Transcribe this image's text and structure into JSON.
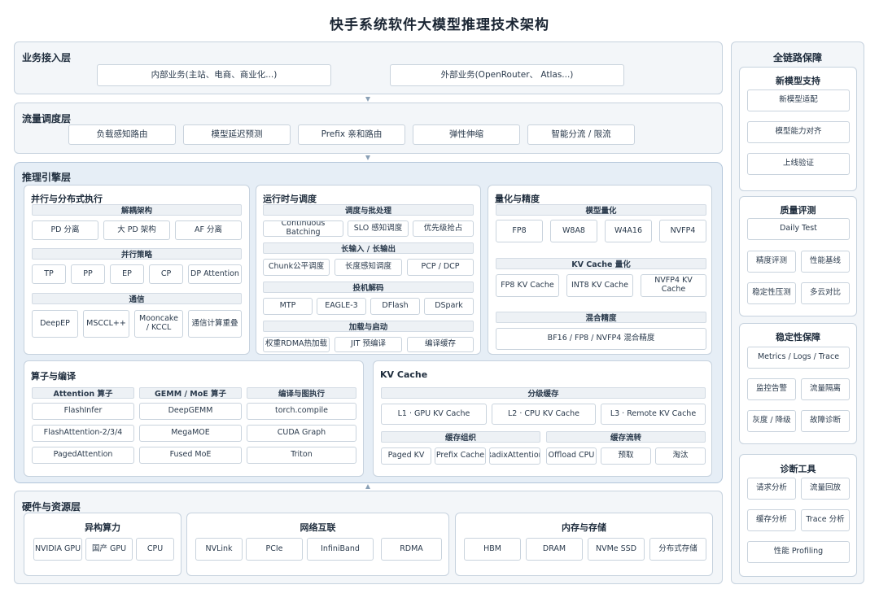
{
  "title": "快手系统软件大模型推理技术架构",
  "business_layer": {
    "title": "业务接入层",
    "items": [
      "内部业务(主站、电商、商业化...)",
      "外部业务(OpenRouter、 Atlas...)"
    ]
  },
  "traffic_layer": {
    "title": "流量调度层",
    "items": [
      "负载感知路由",
      "模型延迟预测",
      "Prefix 亲和路由",
      "弹性伸缩",
      "智能分流 / 限流"
    ]
  },
  "engine_layer": {
    "title": "推理引擎层",
    "parallel": {
      "title": "并行与分布式执行",
      "sections": [
        {
          "header": "解耦架构",
          "items": [
            "PD 分离",
            "大 PD 架构",
            "AF 分离"
          ]
        },
        {
          "header": "并行策略",
          "items": [
            "TP",
            "PP",
            "EP",
            "CP",
            "DP Attention"
          ]
        },
        {
          "header": "通信",
          "items": [
            "DeepEP",
            "MSCCL++",
            "Mooncake\n/ KCCL",
            "通信计算重叠"
          ]
        }
      ]
    },
    "runtime": {
      "title": "运行时与调度",
      "sections": [
        {
          "header": "调度与批处理",
          "items": [
            "Continuous Batching",
            "SLO 感知调度",
            "优先级抢占"
          ]
        },
        {
          "header": "长输入 / 长输出",
          "items": [
            "Chunk公平调度",
            "长度感知调度",
            "PCP / DCP"
          ]
        },
        {
          "header": "投机解码",
          "items": [
            "MTP",
            "EAGLE-3",
            "DFlash",
            "DSpark"
          ]
        },
        {
          "header": "加载与启动",
          "items": [
            "权重RDMA热加载",
            "JIT 预编译",
            "编译缓存"
          ]
        }
      ]
    },
    "quant": {
      "title": "量化与精度",
      "sections": [
        {
          "header": "模型量化",
          "items": [
            "FP8",
            "W8A8",
            "W4A16",
            "NVFP4"
          ]
        },
        {
          "header": "KV Cache 量化",
          "items": [
            "FP8 KV Cache",
            "INT8 KV Cache",
            "NVFP4 KV Cache"
          ]
        },
        {
          "header": "混合精度",
          "items": [
            "BF16 / FP8 / NVFP4 混合精度"
          ]
        }
      ]
    },
    "kernel": {
      "title": "算子与编译",
      "columns": [
        {
          "header": "Attention 算子",
          "items": [
            "FlashInfer",
            "FlashAttention-2/3/4",
            "PagedAttention"
          ]
        },
        {
          "header": "GEMM / MoE 算子",
          "items": [
            "DeepGEMM",
            "MegaMOE",
            "Fused MoE"
          ]
        },
        {
          "header": "编译与图执行",
          "items": [
            "torch.compile",
            "CUDA Graph",
            "Triton"
          ]
        }
      ]
    },
    "kvcache": {
      "title": "KV Cache",
      "tier": {
        "header": "分级缓存",
        "items": [
          "L1 · GPU KV Cache",
          "L2 · CPU KV Cache",
          "L3 · Remote KV Cache"
        ]
      },
      "org": {
        "header": "缓存组织",
        "items": [
          "Paged KV",
          "Prefix Cache",
          "RadixAttention"
        ]
      },
      "flow": {
        "header": "缓存流转",
        "items": [
          "Offload CPU",
          "预取",
          "淘汰"
        ]
      }
    }
  },
  "hardware_layer": {
    "title": "硬件与资源层",
    "groups": [
      {
        "title": "异构算力",
        "items": [
          "NVIDIA GPU",
          "国产 GPU",
          "CPU"
        ]
      },
      {
        "title": "网络互联",
        "items": [
          "NVLink",
          "PCIe",
          "InfiniBand",
          "RDMA"
        ]
      },
      {
        "title": "内存与存储",
        "items": [
          "HBM",
          "DRAM",
          "NVMe SSD",
          "分布式存储"
        ]
      }
    ]
  },
  "guarantee": {
    "title": "全链路保障",
    "groups": [
      {
        "title": "新模型支持",
        "items": [
          "新模型适配",
          "模型能力对齐",
          "上线验证"
        ]
      },
      {
        "title": "质量评测",
        "items": [
          "Daily Test",
          "精度评测",
          "性能基线",
          "稳定性压测",
          "多云对比"
        ]
      },
      {
        "title": "稳定性保障",
        "items": [
          "Metrics / Logs / Trace",
          "监控告警",
          "流量隔离",
          "灰度 / 降级",
          "故障诊断"
        ]
      },
      {
        "title": "诊断工具",
        "items": [
          "请求分析",
          "流量回放",
          "缓存分析",
          "Trace 分析",
          "性能 Profiling"
        ]
      }
    ]
  }
}
